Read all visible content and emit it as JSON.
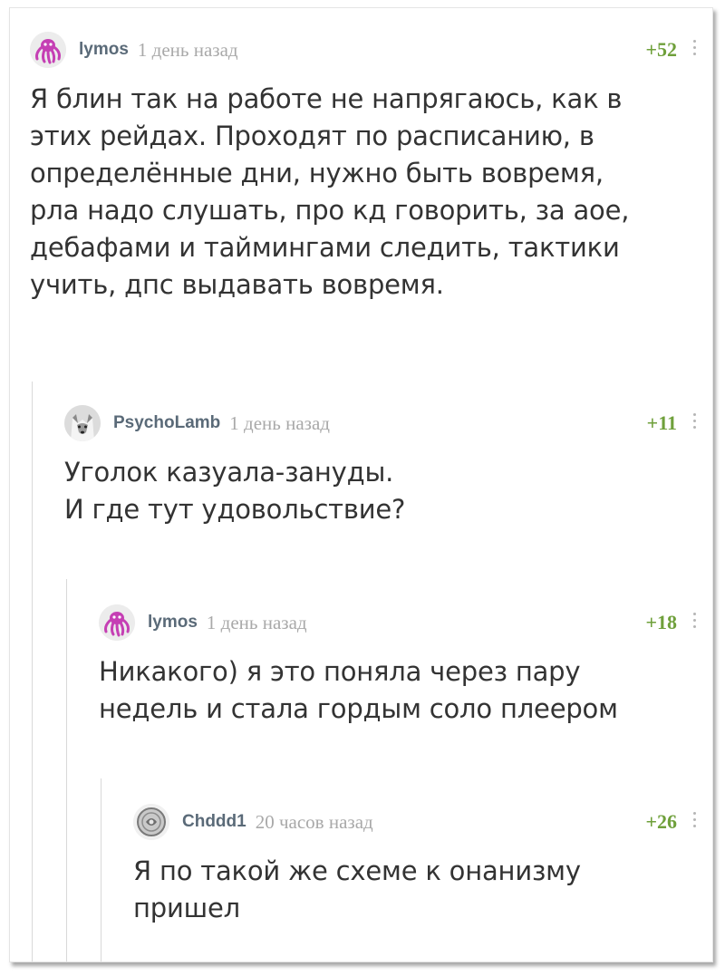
{
  "comments": [
    {
      "author": "lymos",
      "time": "1 день назад",
      "rating": "+52",
      "avatar_icon": "octopus-avatar",
      "lines": [
        "Я блин так на работе не напрягаюсь, как в",
        "этих рейдах. Проходят по расписанию, в",
        "определённые дни, нужно быть вовремя,",
        "рла надо слушать, про кд говорить, за аое,",
        "дебафами и таймингами следить, тактики",
        "учить, дпс выдавать вовремя."
      ]
    },
    {
      "author": "PsychoLamb",
      "time": "1 день назад",
      "rating": "+11",
      "avatar_icon": "wolf-avatar",
      "lines": [
        "Уголок казуала-зануды.",
        "И где тут удовольствие?"
      ]
    },
    {
      "author": "lymos",
      "time": "1 день назад",
      "rating": "+18",
      "avatar_icon": "octopus-avatar",
      "lines": [
        "Никакого) я это поняла через пару",
        "недель и стала гордым соло плеером"
      ]
    },
    {
      "author": "Chddd1",
      "time": "20 часов назад",
      "rating": "+26",
      "avatar_icon": "coin-avatar",
      "lines": [
        "Я по такой же схеме к онанизму",
        "пришел"
      ]
    }
  ],
  "colors": {
    "author": "#5a6a78",
    "time": "#a9a9a9",
    "rating": "#6fa03b",
    "text": "#333333",
    "thread_line": "#d9d9d9"
  }
}
